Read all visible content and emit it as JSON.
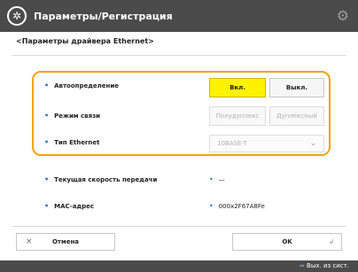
{
  "window": {
    "title": "Параметры/Регистрация"
  },
  "page": {
    "subtitle": "<Параметры драйвера Ethernet>"
  },
  "settings": {
    "auto_detect": {
      "label": "Автоопределение",
      "options": [
        "Вкл.",
        "Выкл."
      ],
      "selected": "Вкл."
    },
    "comm_mode": {
      "label": "Режим связи",
      "options": [
        "Полудуплекс",
        "Дуплексный"
      ],
      "disabled": true
    },
    "ethernet_type": {
      "label": "Тип Ethernet",
      "value": "10BASE-T",
      "disabled": true
    }
  },
  "info": {
    "tx_speed": {
      "label": "Текущая скорость передачи",
      "value": "—"
    },
    "mac": {
      "label": "MAC-адрес",
      "value": "000х2F67A8Fe"
    }
  },
  "footer": {
    "cancel_label": "Отмена",
    "ok_label": "OK"
  },
  "status": {
    "text": "Вых. из сист."
  }
}
